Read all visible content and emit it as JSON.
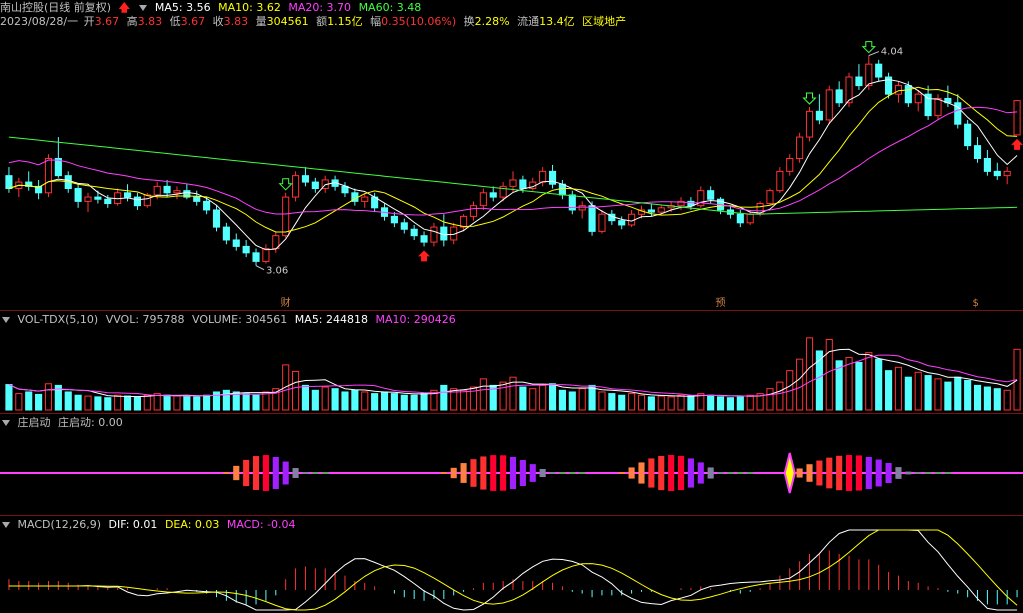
{
  "stock": {
    "name": "南山控股",
    "period": "(日线 前复权)",
    "ma5": "MA5: 3.56",
    "ma10": "MA10: 3.62",
    "ma20": "MA20: 3.70",
    "ma60": "MA60: 3.48",
    "date": "2023/08/28/一",
    "open_label": "开",
    "open": "3.67",
    "high_label": "高",
    "high": "3.83",
    "low_label": "低",
    "low": "3.67",
    "close_label": "收",
    "close": "3.83",
    "vol_label": "量",
    "vol": "304561",
    "amt_label": "额",
    "amt": "1.15亿",
    "chg_label": "幅",
    "chg": "0.35(10.06%)",
    "turnover_label": "换",
    "turnover": "2.28%",
    "float_label": "流通",
    "float": "13.4亿",
    "sector": "区域地产",
    "high_mark": "4.04",
    "low_mark": "3.06",
    "event_labels": [
      "财",
      "预",
      "$"
    ]
  },
  "volume_pane": {
    "title": "VOL-TDX(5,10)",
    "vvol": "VVOL: 795788",
    "volume": "VOLUME: 304561",
    "ma5": "MA5: 244818",
    "ma10": "MA10: 290426"
  },
  "zhuang_pane": {
    "title": "庄启动",
    "value": "庄启动: 0.00"
  },
  "macd_pane": {
    "title": "MACD(12,26,9)",
    "dif": "DIF: 0.01",
    "dea": "DEA: 0.03",
    "macd": "MACD: -0.04"
  },
  "colors": {
    "up": "#ff3232",
    "down": "#54ffff",
    "ma5": "#ffffff",
    "ma10": "#ffff00",
    "ma20": "#ff40ff",
    "ma60": "#40ff40",
    "label_gray": "#c0c0c0"
  },
  "chart_data": {
    "type": "candlestick",
    "price_range": [
      2.9,
      4.15
    ],
    "ohlc": [
      [
        3.48,
        3.52,
        3.4,
        3.42
      ],
      [
        3.42,
        3.47,
        3.38,
        3.45
      ],
      [
        3.45,
        3.5,
        3.41,
        3.43
      ],
      [
        3.43,
        3.46,
        3.37,
        3.4
      ],
      [
        3.4,
        3.58,
        3.38,
        3.56
      ],
      [
        3.56,
        3.66,
        3.47,
        3.48
      ],
      [
        3.48,
        3.5,
        3.4,
        3.42
      ],
      [
        3.42,
        3.44,
        3.33,
        3.36
      ],
      [
        3.36,
        3.4,
        3.31,
        3.38
      ],
      [
        3.38,
        3.41,
        3.35,
        3.37
      ],
      [
        3.37,
        3.39,
        3.33,
        3.35
      ],
      [
        3.35,
        3.42,
        3.34,
        3.4
      ],
      [
        3.4,
        3.44,
        3.36,
        3.38
      ],
      [
        3.38,
        3.4,
        3.32,
        3.34
      ],
      [
        3.34,
        3.4,
        3.33,
        3.39
      ],
      [
        3.39,
        3.45,
        3.37,
        3.43
      ],
      [
        3.43,
        3.46,
        3.38,
        3.4
      ],
      [
        3.4,
        3.43,
        3.37,
        3.41
      ],
      [
        3.41,
        3.44,
        3.37,
        3.38
      ],
      [
        3.38,
        3.41,
        3.34,
        3.36
      ],
      [
        3.36,
        3.38,
        3.3,
        3.32
      ],
      [
        3.32,
        3.34,
        3.22,
        3.24
      ],
      [
        3.24,
        3.26,
        3.16,
        3.18
      ],
      [
        3.18,
        3.21,
        3.13,
        3.15
      ],
      [
        3.15,
        3.18,
        3.1,
        3.12
      ],
      [
        3.12,
        3.14,
        3.06,
        3.08
      ],
      [
        3.08,
        3.16,
        3.07,
        3.14
      ],
      [
        3.14,
        3.22,
        3.12,
        3.2
      ],
      [
        3.2,
        3.4,
        3.19,
        3.38
      ],
      [
        3.38,
        3.5,
        3.36,
        3.48
      ],
      [
        3.48,
        3.52,
        3.43,
        3.45
      ],
      [
        3.45,
        3.47,
        3.4,
        3.42
      ],
      [
        3.42,
        3.48,
        3.4,
        3.46
      ],
      [
        3.46,
        3.48,
        3.41,
        3.43
      ],
      [
        3.43,
        3.45,
        3.38,
        3.4
      ],
      [
        3.4,
        3.42,
        3.34,
        3.36
      ],
      [
        3.36,
        3.4,
        3.33,
        3.38
      ],
      [
        3.38,
        3.4,
        3.31,
        3.33
      ],
      [
        3.33,
        3.35,
        3.27,
        3.29
      ],
      [
        3.29,
        3.31,
        3.24,
        3.26
      ],
      [
        3.26,
        3.28,
        3.21,
        3.23
      ],
      [
        3.23,
        3.25,
        3.18,
        3.2
      ],
      [
        3.2,
        3.22,
        3.15,
        3.17
      ],
      [
        3.17,
        3.26,
        3.15,
        3.24
      ],
      [
        3.24,
        3.3,
        3.15,
        3.18
      ],
      [
        3.18,
        3.26,
        3.16,
        3.24
      ],
      [
        3.24,
        3.3,
        3.22,
        3.29
      ],
      [
        3.29,
        3.36,
        3.27,
        3.34
      ],
      [
        3.34,
        3.42,
        3.32,
        3.4
      ],
      [
        3.4,
        3.43,
        3.36,
        3.38
      ],
      [
        3.38,
        3.45,
        3.36,
        3.43
      ],
      [
        3.43,
        3.5,
        3.4,
        3.46
      ],
      [
        3.46,
        3.48,
        3.4,
        3.42
      ],
      [
        3.42,
        3.47,
        3.41,
        3.45
      ],
      [
        3.45,
        3.52,
        3.43,
        3.5
      ],
      [
        3.5,
        3.53,
        3.42,
        3.44
      ],
      [
        3.44,
        3.46,
        3.37,
        3.39
      ],
      [
        3.39,
        3.41,
        3.3,
        3.32
      ],
      [
        3.32,
        3.36,
        3.28,
        3.34
      ],
      [
        3.34,
        3.36,
        3.2,
        3.22
      ],
      [
        3.22,
        3.32,
        3.21,
        3.3
      ],
      [
        3.3,
        3.32,
        3.25,
        3.27
      ],
      [
        3.27,
        3.29,
        3.23,
        3.25
      ],
      [
        3.25,
        3.32,
        3.24,
        3.3
      ],
      [
        3.3,
        3.34,
        3.28,
        3.32
      ],
      [
        3.32,
        3.35,
        3.29,
        3.31
      ],
      [
        3.31,
        3.34,
        3.3,
        3.33
      ],
      [
        3.33,
        3.36,
        3.31,
        3.34
      ],
      [
        3.34,
        3.38,
        3.32,
        3.36
      ],
      [
        3.36,
        3.38,
        3.32,
        3.34
      ],
      [
        3.34,
        3.43,
        3.33,
        3.41
      ],
      [
        3.41,
        3.43,
        3.35,
        3.37
      ],
      [
        3.37,
        3.38,
        3.3,
        3.32
      ],
      [
        3.32,
        3.34,
        3.28,
        3.3
      ],
      [
        3.3,
        3.32,
        3.24,
        3.26
      ],
      [
        3.26,
        3.32,
        3.25,
        3.3
      ],
      [
        3.3,
        3.36,
        3.29,
        3.35
      ],
      [
        3.35,
        3.42,
        3.34,
        3.41
      ],
      [
        3.41,
        3.52,
        3.4,
        3.5
      ],
      [
        3.5,
        3.58,
        3.48,
        3.56
      ],
      [
        3.56,
        3.68,
        3.54,
        3.66
      ],
      [
        3.66,
        3.8,
        3.64,
        3.78
      ],
      [
        3.78,
        3.86,
        3.72,
        3.74
      ],
      [
        3.74,
        3.9,
        3.72,
        3.88
      ],
      [
        3.88,
        3.92,
        3.8,
        3.82
      ],
      [
        3.82,
        3.96,
        3.8,
        3.94
      ],
      [
        3.94,
        4.0,
        3.88,
        3.9
      ],
      [
        3.9,
        4.04,
        3.88,
        4.0
      ],
      [
        4.0,
        4.02,
        3.92,
        3.94
      ],
      [
        3.94,
        3.96,
        3.84,
        3.86
      ],
      [
        3.86,
        3.92,
        3.82,
        3.9
      ],
      [
        3.9,
        3.92,
        3.8,
        3.82
      ],
      [
        3.82,
        3.88,
        3.78,
        3.86
      ],
      [
        3.86,
        3.9,
        3.74,
        3.76
      ],
      [
        3.76,
        3.86,
        3.74,
        3.84
      ],
      [
        3.84,
        3.9,
        3.8,
        3.82
      ],
      [
        3.82,
        3.86,
        3.7,
        3.72
      ],
      [
        3.72,
        3.74,
        3.6,
        3.62
      ],
      [
        3.62,
        3.66,
        3.54,
        3.56
      ],
      [
        3.56,
        3.6,
        3.48,
        3.5
      ],
      [
        3.5,
        3.54,
        3.46,
        3.48
      ],
      [
        3.48,
        3.52,
        3.44,
        3.5
      ],
      [
        3.67,
        3.83,
        3.67,
        3.83
      ]
    ],
    "volume": [
      0.31,
      0.2,
      0.22,
      0.19,
      0.32,
      0.3,
      0.22,
      0.18,
      0.17,
      0.16,
      0.15,
      0.18,
      0.17,
      0.16,
      0.18,
      0.2,
      0.18,
      0.17,
      0.17,
      0.16,
      0.18,
      0.22,
      0.24,
      0.22,
      0.2,
      0.18,
      0.22,
      0.26,
      0.55,
      0.47,
      0.3,
      0.24,
      0.28,
      0.26,
      0.22,
      0.24,
      0.22,
      0.2,
      0.22,
      0.2,
      0.18,
      0.18,
      0.2,
      0.24,
      0.3,
      0.26,
      0.24,
      0.28,
      0.38,
      0.3,
      0.34,
      0.4,
      0.28,
      0.26,
      0.3,
      0.32,
      0.24,
      0.22,
      0.26,
      0.3,
      0.22,
      0.2,
      0.18,
      0.2,
      0.18,
      0.16,
      0.17,
      0.16,
      0.18,
      0.17,
      0.2,
      0.18,
      0.16,
      0.15,
      0.17,
      0.18,
      0.2,
      0.26,
      0.34,
      0.48,
      0.62,
      0.88,
      0.72,
      0.86,
      0.6,
      0.64,
      0.58,
      0.7,
      0.62,
      0.48,
      0.52,
      0.4,
      0.46,
      0.42,
      0.38,
      0.34,
      0.4,
      0.36,
      0.3,
      0.28,
      0.26,
      0.24,
      0.74
    ],
    "macd_hist": [
      0.06,
      0.05,
      0.05,
      0.04,
      0.05,
      0.05,
      0.04,
      0.03,
      0.02,
      0.02,
      0.01,
      0.01,
      0.01,
      0.0,
      0.0,
      0.01,
      0.01,
      0.0,
      0.0,
      -0.01,
      -0.02,
      -0.04,
      -0.06,
      -0.07,
      -0.08,
      -0.08,
      -0.06,
      -0.03,
      0.06,
      0.12,
      0.13,
      0.12,
      0.12,
      0.1,
      0.08,
      0.05,
      0.04,
      0.02,
      0.0,
      -0.02,
      -0.04,
      -0.05,
      -0.06,
      -0.05,
      -0.05,
      -0.03,
      -0.01,
      0.01,
      0.04,
      0.04,
      0.05,
      0.06,
      0.05,
      0.05,
      0.05,
      0.04,
      0.02,
      -0.01,
      -0.02,
      -0.04,
      -0.03,
      -0.03,
      -0.03,
      -0.02,
      -0.01,
      -0.01,
      -0.0,
      0.0,
      0.01,
      0.01,
      0.02,
      0.01,
      0.0,
      -0.01,
      -0.02,
      -0.01,
      0.01,
      0.04,
      0.08,
      0.12,
      0.16,
      0.2,
      0.2,
      0.22,
      0.2,
      0.19,
      0.17,
      0.17,
      0.14,
      0.1,
      0.08,
      0.05,
      0.04,
      0.02,
      0.01,
      -0.01,
      -0.02,
      -0.04,
      -0.06,
      -0.08,
      -0.08,
      -0.08,
      -0.04
    ]
  }
}
